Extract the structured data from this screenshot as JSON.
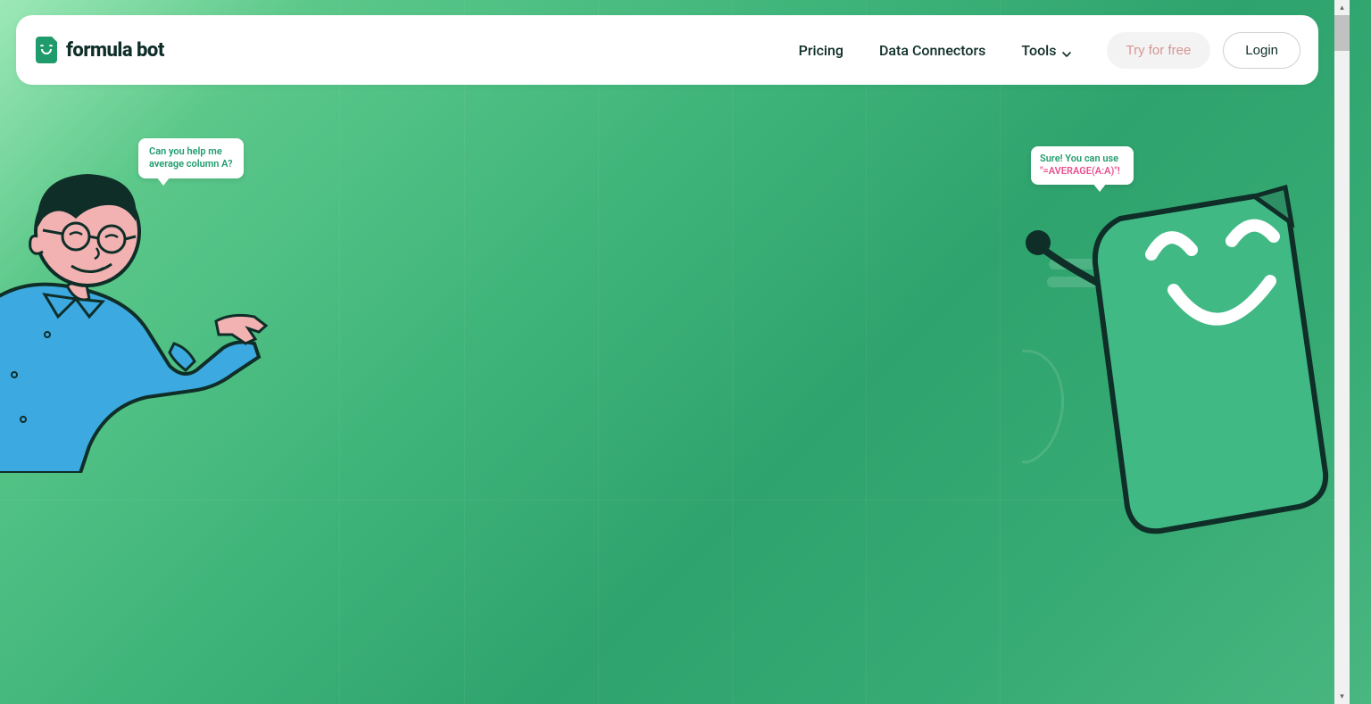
{
  "brand": {
    "name": "formula bot"
  },
  "nav": {
    "links": [
      {
        "label": "Pricing"
      },
      {
        "label": "Data Connectors"
      },
      {
        "label": "Tools",
        "hasDropdown": true
      }
    ],
    "tryButton": "Try for free",
    "loginButton": "Login"
  },
  "hero": {
    "userBubble": "Can you help me average column A?",
    "botBubbleLine1": "Sure! You can use ",
    "botBubbleLine2": "\"=AVERAGE(A:A)\"!"
  }
}
